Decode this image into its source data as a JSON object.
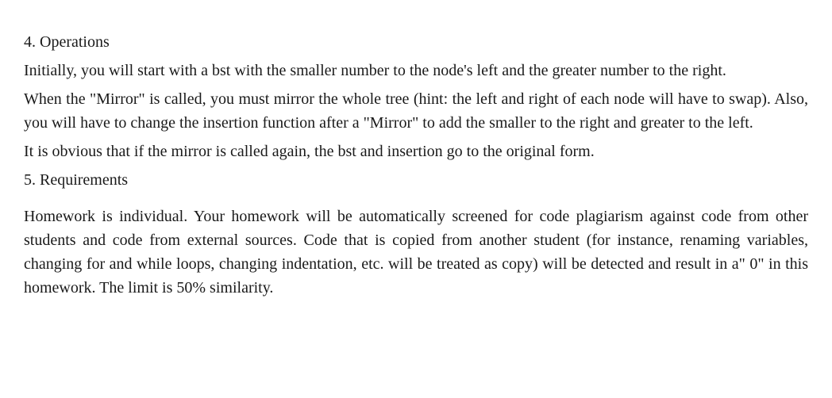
{
  "section4": {
    "heading": "4. Operations",
    "para1": "Initially, you will start with a bst with the smaller number to the node's left and the greater number to the right.",
    "para2": "When the \"Mirror\" is called, you must mirror the whole tree (hint: the left and right of each node will have to swap). Also, you will have to change the insertion function after a \"Mirror\" to add the smaller to the right and greater to the left.",
    "para3": "It is obvious that if the mirror is called again, the bst and insertion go to the original form."
  },
  "section5": {
    "heading": "5. Requirements",
    "para1": "Homework is individual. Your homework will be automatically screened for code plagiarism against code from other students and code from external sources. Code that is copied from another student (for instance, renaming variables, changing for and while loops, changing indentation, etc. will be treated as copy) will be detected and result in a\" 0\" in this homework. The limit is 50% similarity."
  }
}
